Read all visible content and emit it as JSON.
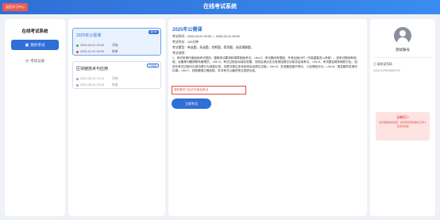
{
  "header": {
    "title": "在线考试系统",
    "back_label": "返回学习中心"
  },
  "sidebar": {
    "title": "在线考试系统",
    "items": [
      {
        "label": "我的考试",
        "active": true,
        "icon": "exam-icon"
      },
      {
        "label": "考试记录",
        "active": false,
        "icon": "clock-icon"
      }
    ]
  },
  "exam_list": [
    {
      "title": "2025年公需课",
      "tag": "进行中",
      "start_time": "2025-04-01 00:00",
      "start_label": "开始",
      "end_time": "2026-01-01 00:00",
      "end_label": "结束"
    },
    {
      "title": "区块链技术与应用",
      "tag": "已结束",
      "start_time": "2021-03-10 23:14",
      "start_label": "开始",
      "end_time": "2022-03-31 23:15",
      "end_label": "结束"
    }
  ],
  "detail": {
    "title": "2025年公需课",
    "time_line": "考试时间：2025-04-01 00:00 — 2026-01-01 00:00",
    "duration_line": "考试时长：120分钟",
    "types_line": "考试题型：单选题，多选题，判断题，简答题，阅读理解题。",
    "rules_heading": "考试说明：",
    "rules_text": "1、考试前请仔细阅读考试规则，遵照考试要求和规章制度考试。</br>2、考试期间有限制，开考后倒计时（不能重复进入考卷）；如考试期间有网络、设备等问题请联系管理员。</br>3、考试过程自动保存答题，完成后请点击交卷按钮提交试卷并结束考试。</br>4、考试题目顺序随机打乱，如您在考试过程中出现切屏行为将被记录，切屏次数过多系统将自动提交试卷；</br>5、多选题选错不得分，少选得部分分；</br>6、简答题作答请勿抄袭；</br>7、判断题请正确选择。本次考试以最终提交成绩为准。",
    "notice": "请完整学习后方可参加考试",
    "enter_button": "立即考试"
  },
  "profile": {
    "name": "测试账号",
    "id_label": "身份证号码",
    "id_value": "340123199008082125",
    "tip_title": "温馨提示",
    "tip_body": "请仔细阅读并检查，如出现问题请联系工作人员及时处理"
  }
}
